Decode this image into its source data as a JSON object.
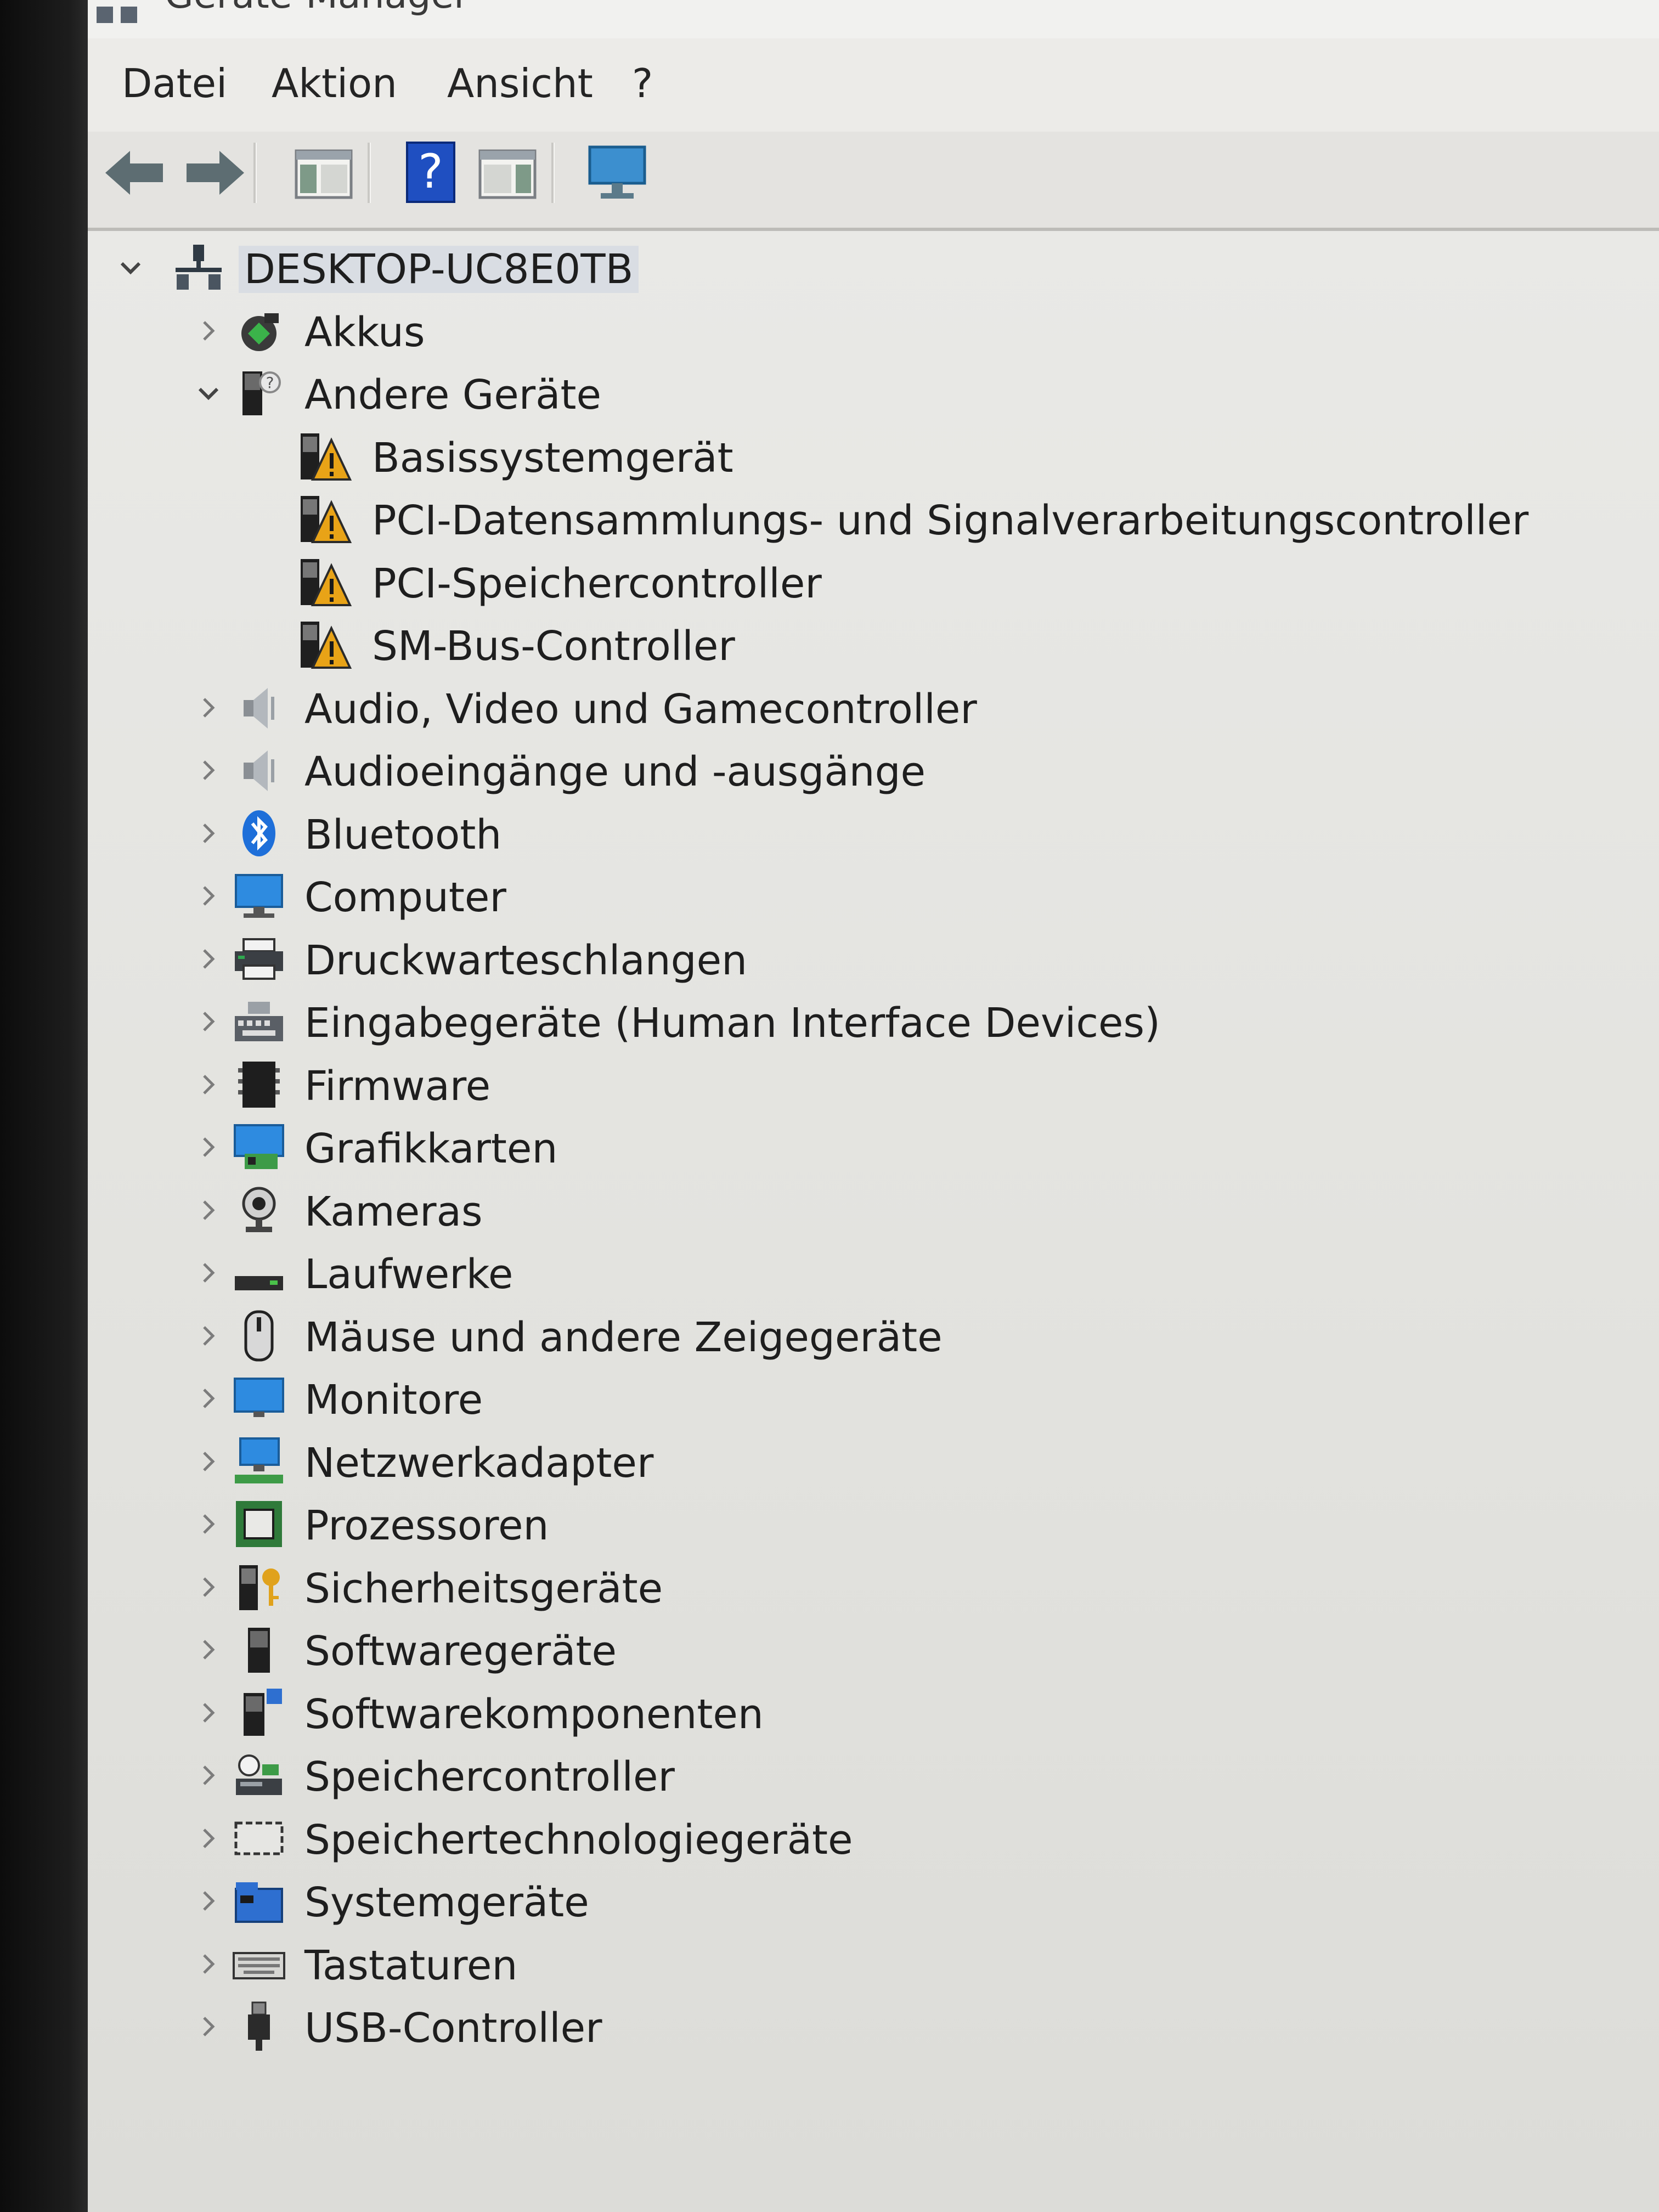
{
  "window": {
    "title": "Geräte-Manager"
  },
  "menu": {
    "items": [
      "Datei",
      "Aktion",
      "Ansicht",
      "?"
    ]
  },
  "tree": {
    "root": "DESKTOP-UC8E0TB",
    "items": [
      {
        "label": "Akkus",
        "icon": "battery-icon",
        "expanded": false
      },
      {
        "label": "Andere Geräte",
        "icon": "other-devices-icon",
        "expanded": true,
        "children": [
          {
            "label": "Basissystemgerät",
            "icon": "warning-device-icon"
          },
          {
            "label": "PCI-Datensammlungs- und Signalverarbeitungscontroller",
            "icon": "warning-device-icon"
          },
          {
            "label": "PCI-Speichercontroller",
            "icon": "warning-device-icon"
          },
          {
            "label": "SM-Bus-Controller",
            "icon": "warning-device-icon"
          }
        ]
      },
      {
        "label": "Audio, Video und Gamecontroller",
        "icon": "speaker-icon",
        "expanded": false
      },
      {
        "label": "Audioeingänge und -ausgänge",
        "icon": "speaker-icon",
        "expanded": false
      },
      {
        "label": "Bluetooth",
        "icon": "bluetooth-icon",
        "expanded": false
      },
      {
        "label": "Computer",
        "icon": "computer-icon",
        "expanded": false
      },
      {
        "label": "Druckwarteschlangen",
        "icon": "printer-icon",
        "expanded": false
      },
      {
        "label": "Eingabegeräte (Human Interface Devices)",
        "icon": "hid-icon",
        "expanded": false
      },
      {
        "label": "Firmware",
        "icon": "firmware-icon",
        "expanded": false
      },
      {
        "label": "Grafikkarten",
        "icon": "display-adapter-icon",
        "expanded": false
      },
      {
        "label": "Kameras",
        "icon": "camera-icon",
        "expanded": false
      },
      {
        "label": "Laufwerke",
        "icon": "drive-icon",
        "expanded": false
      },
      {
        "label": "Mäuse und andere Zeigegeräte",
        "icon": "mouse-icon",
        "expanded": false
      },
      {
        "label": "Monitore",
        "icon": "monitor-icon",
        "expanded": false
      },
      {
        "label": "Netzwerkadapter",
        "icon": "network-icon",
        "expanded": false
      },
      {
        "label": "Prozessoren",
        "icon": "processor-icon",
        "expanded": false
      },
      {
        "label": "Sicherheitsgeräte",
        "icon": "security-device-icon",
        "expanded": false
      },
      {
        "label": "Softwaregeräte",
        "icon": "software-device-icon",
        "expanded": false
      },
      {
        "label": "Softwarekomponenten",
        "icon": "software-component-icon",
        "expanded": false
      },
      {
        "label": "Speichercontroller",
        "icon": "storage-controller-icon",
        "expanded": false
      },
      {
        "label": "Speichertechnologiegeräte",
        "icon": "memory-technology-icon",
        "expanded": false
      },
      {
        "label": "Systemgeräte",
        "icon": "system-device-icon",
        "expanded": false
      },
      {
        "label": "Tastaturen",
        "icon": "keyboard-icon",
        "expanded": false
      },
      {
        "label": "USB-Controller",
        "icon": "usb-icon",
        "expanded": false
      }
    ]
  },
  "colors": {
    "accent": "#2b7fd6",
    "warning": "#e8a317",
    "selection": "#d9dde3"
  }
}
